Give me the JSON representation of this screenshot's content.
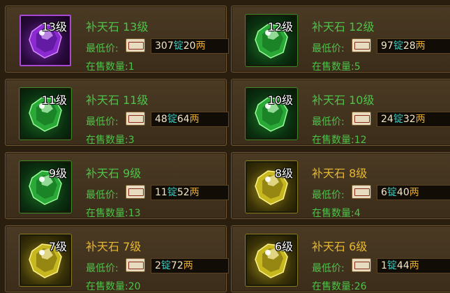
{
  "unit_ding": "锭",
  "unit_liang": "两",
  "price_label": "最低价:",
  "count_label_prefix": "在售数量:",
  "colors": {
    "name_green": "#4ec24a",
    "name_yellow": "#e6b832",
    "ding_cyan": "#36c8c0",
    "liang_gold": "#e0a830"
  },
  "items": [
    {
      "level_badge": "13级",
      "name": "补天石 13级",
      "gem_color": "purple",
      "ding": "307",
      "liang": "20",
      "count": "1"
    },
    {
      "level_badge": "12级",
      "name": "补天石 12级",
      "gem_color": "green",
      "ding": "97",
      "liang": "28",
      "count": "5"
    },
    {
      "level_badge": "11级",
      "name": "补天石 11级",
      "gem_color": "green",
      "ding": "48",
      "liang": "64",
      "count": "3"
    },
    {
      "level_badge": "10级",
      "name": "补天石 10级",
      "gem_color": "green",
      "ding": "24",
      "liang": "32",
      "count": "12"
    },
    {
      "level_badge": "9级",
      "name": "补天石 9级",
      "gem_color": "green",
      "ding": "11",
      "liang": "52",
      "count": "13"
    },
    {
      "level_badge": "8级",
      "name": "补天石 8级",
      "gem_color": "yellow",
      "ding": "6",
      "liang": "40",
      "count": "4"
    },
    {
      "level_badge": "7级",
      "name": "补天石 7级",
      "gem_color": "yellow",
      "ding": "2",
      "liang": "72",
      "count": "20"
    },
    {
      "level_badge": "6级",
      "name": "补天石 6级",
      "gem_color": "yellow",
      "ding": "1",
      "liang": "44",
      "count": "26"
    }
  ]
}
